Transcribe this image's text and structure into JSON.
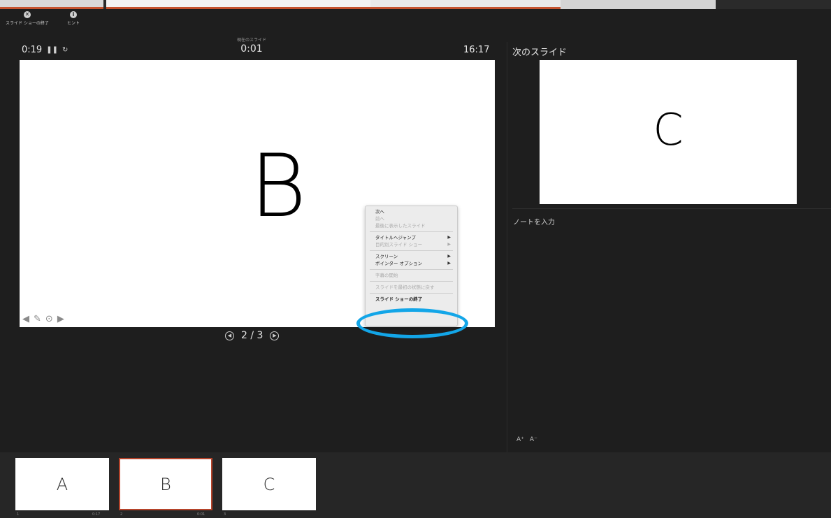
{
  "toolbar": {
    "end_show_label": "スライド ショーの終了",
    "hint_label": "ヒント"
  },
  "timer": {
    "elapsed": "0:19",
    "slide_time_label": "現在のスライド",
    "slide_time": "0:01",
    "clock": "16:17"
  },
  "main_slide": {
    "content": "B"
  },
  "context_menu": {
    "items": [
      {
        "label": "次へ",
        "enabled": true
      },
      {
        "label": "前へ",
        "enabled": false
      },
      {
        "label": "最後に表示したスライド",
        "enabled": false
      },
      {
        "label": "タイトルへジャンプ",
        "enabled": true,
        "submenu": true
      },
      {
        "label": "目的別スライド ショー",
        "enabled": false,
        "submenu": true
      },
      {
        "label": "スクリーン",
        "enabled": true,
        "submenu": true
      },
      {
        "label": "ポインター オプション",
        "enabled": true,
        "submenu": true
      },
      {
        "label": "字幕の開始",
        "enabled": false
      },
      {
        "label": "スライドを最初の状態に戻す",
        "enabled": false
      },
      {
        "label": "スライド ショーの終了",
        "enabled": true
      }
    ],
    "highlight_color": "#13a6e8"
  },
  "navigation": {
    "position": "2 / 3"
  },
  "next_slide": {
    "title": "次のスライド",
    "content": "C"
  },
  "notes": {
    "placeholder": "ノートを入力",
    "font_increase": "A⁺",
    "font_decrease": "A⁻"
  },
  "thumbnails": [
    {
      "letter": "A",
      "number": "1",
      "time": "0:17",
      "active": false
    },
    {
      "letter": "B",
      "number": "2",
      "time": "0:01",
      "active": true
    },
    {
      "letter": "C",
      "number": "3",
      "time": "",
      "active": false
    }
  ],
  "colors": {
    "accent": "#c5532f",
    "highlight": "#13a6e8",
    "background": "#1e1e1e"
  }
}
